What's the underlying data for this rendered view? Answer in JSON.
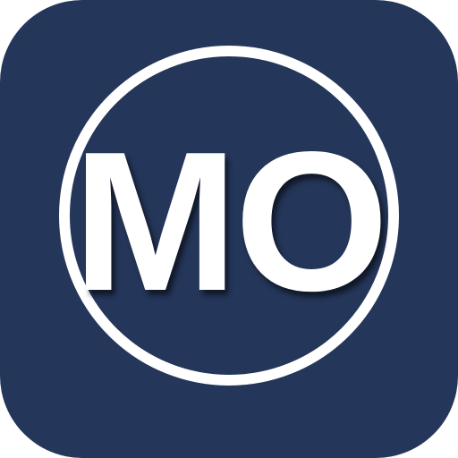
{
  "app_icon": {
    "monogram": "MO",
    "icon_name": "mo-monogram-app-icon"
  },
  "colors": {
    "background": "#243659",
    "foreground": "#ffffff"
  }
}
